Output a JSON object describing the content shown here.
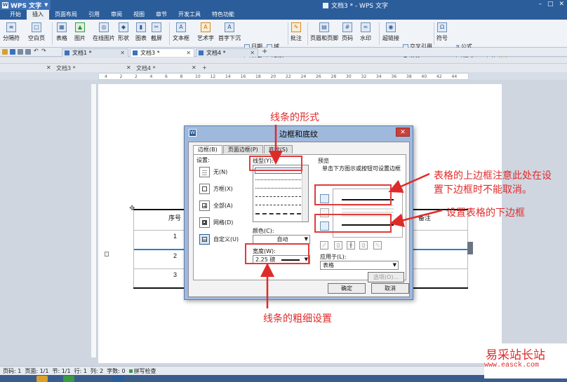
{
  "app": {
    "name": "WPS 文字",
    "doc_title": "文档3 * - WPS 文字"
  },
  "menu_tabs": [
    "开始",
    "插入",
    "页面布局",
    "引用",
    "审阅",
    "视图",
    "章节",
    "开发工具",
    "特色功能"
  ],
  "ribbon": {
    "page_break": "分隔符",
    "blank_page": "空白页",
    "table": "表格",
    "picture": "图片",
    "online_picture": "在线图片",
    "shape": "形状",
    "chart": "图表",
    "screenshot": "截屏",
    "text_box": "文本框",
    "word_art": "艺术字",
    "drop_cap": "首字下沉",
    "date": "日期",
    "field": "域",
    "object": "对象",
    "attachment": "附件",
    "comment": "批注",
    "header_footer": "页眉和页脚",
    "page_number": "页码",
    "watermark": "水印",
    "hyperlink": "超链接",
    "cross_reference": "交叉引用",
    "bookmark": "书签",
    "symbol": "符号",
    "formula": "公式",
    "number": "数字"
  },
  "doc_tabs": [
    "文档1 *",
    "文档3 *",
    "文档4 *"
  ],
  "ghost_tabs": [
    "文档3 *",
    "文档4 *"
  ],
  "ruler_numbers": [
    "4",
    "2",
    "2",
    "4",
    "6",
    "8",
    "10",
    "12",
    "14",
    "16",
    "18",
    "20",
    "22",
    "24",
    "26",
    "28",
    "30",
    "32",
    "34",
    "36",
    "38",
    "40",
    "42",
    "44"
  ],
  "table": {
    "header_left": "序号",
    "header_right": "备注",
    "rows": [
      "1",
      "2",
      "3"
    ]
  },
  "dialog": {
    "title": "边框和底纹",
    "close": "✕",
    "tabs": [
      "边框(B)",
      "页面边框(P)",
      "底纹(S)"
    ],
    "settings_label": "设置:",
    "settings": [
      "无(N)",
      "方框(X)",
      "全部(A)",
      "网格(D)",
      "自定义(U)"
    ],
    "line_style_label": "线型(Y):",
    "color_label": "颜色(C):",
    "color_value": "自动",
    "width_label": "宽度(W):",
    "width_value": "2.25 磅",
    "preview_label": "预览",
    "preview_hint": "单击下方图示或按钮可设置边框",
    "apply_to_label": "应用于(L):",
    "apply_to_value": "表格",
    "options_button": "选项(O)...",
    "ok_button": "确定",
    "cancel_button": "取消"
  },
  "annotations": {
    "line_form": "线条的形式",
    "top_border_note_1": "表格的上边框注意此处在设",
    "top_border_note_2": "置下边框时不能取消。",
    "bottom_border_note": "设置表格的下边框",
    "thickness_note": "线条的粗细设置"
  },
  "status": {
    "page": "页码: 1",
    "pages": "页面: 1/1",
    "section": "节: 1/1",
    "row": "行: 1",
    "col": "列: 2",
    "words": "字数: 0",
    "spell": "拼写检查"
  },
  "watermark_brand": {
    "name": "易采站长站",
    "url": "www.easck.com"
  },
  "colors": {
    "title_bar": "#2b5d9a",
    "annotation_red": "#e02a2a",
    "table_blue_line": "#2b7bd4"
  }
}
